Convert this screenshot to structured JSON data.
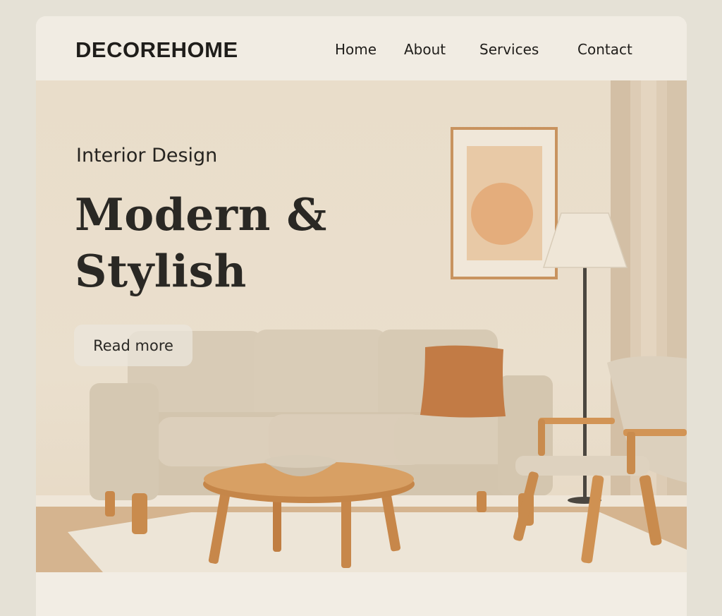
{
  "brand": {
    "name": "DECOREHOME"
  },
  "nav": {
    "items": [
      {
        "label": "Home"
      },
      {
        "label": "About"
      },
      {
        "label": "Services"
      },
      {
        "label": "Contact"
      }
    ]
  },
  "hero": {
    "kicker": "Interior Design",
    "headline_line1": "Modern &",
    "headline_line2": "Stylish",
    "cta_label": "Read more",
    "image_description_icons": [
      "sofa",
      "cushion",
      "framed-art",
      "floor-lamp",
      "coffee-table",
      "bowl",
      "armchair",
      "rug",
      "curtain"
    ]
  },
  "colors": {
    "background": "#e5e1d6",
    "card": "#f1ece2",
    "wall": "#e9ddca",
    "sofa": "#d9ccb7",
    "accent_terracotta": "#c27b45",
    "wood": "#d29a5c",
    "text": "#1f1d1a"
  }
}
